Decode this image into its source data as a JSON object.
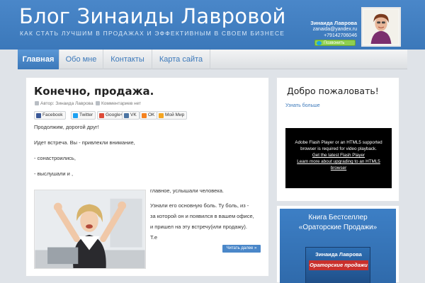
{
  "header": {
    "title": "Блог Зинаиды Лавровой",
    "tagline": "Как стать лучшим в продажах и эффективным в своем бизнесе",
    "contact": {
      "name": "Зинаида Лаврова",
      "email": "zanaida@yandex.ru",
      "phone": "+79142706046",
      "call_label": "Позвонить",
      "call_icon": "skype-icon"
    }
  },
  "nav": {
    "items": [
      "Главная",
      "Обо мне",
      "Контакты",
      "Карта сайта"
    ],
    "active": "Главная"
  },
  "post": {
    "title": "Конечно, продажа.",
    "author": "Автор: Зинаида Лаврова",
    "comments": "Комментариев нет",
    "share": [
      {
        "label": "Facebook",
        "color": "#3b5998"
      },
      {
        "label": "Twitter",
        "color": "#1da1f2"
      },
      {
        "label": "Google+",
        "color": "#dd4b39"
      },
      {
        "label": "VK",
        "color": "#4c75a3"
      },
      {
        "label": "OK",
        "color": "#f58220"
      },
      {
        "label": "Мой Мир",
        "color": "#f5a623"
      }
    ],
    "paragraphs": [
      "Продолжим, дорогой друг!",
      "Идет встреча. Вы - привлекли внимание,",
      "- сонастроились,",
      "- выслушали и ,"
    ],
    "side_text": [
      "главное, услышали человека.",
      "Узнали его основную боль. Ту боль, из -",
      "за которой он и появился в вашем офисе,",
      "и пришел на эту встречу(или продажу).",
      "Т.е"
    ],
    "read_more": "Читать далее »"
  },
  "sidebar": {
    "welcome": {
      "title": "Добро пожаловать!",
      "link": "Узнать больше",
      "video_message": [
        "Adobe Flash Player or an HTML5 supported",
        "browser is required for video playback.",
        "Get the latest Flash Player",
        "Learn more about upgrading to an HTML5",
        "browser"
      ]
    },
    "book": {
      "title_line1": "Книга Бестселлер",
      "title_line2": "«Ораторские Продажи»",
      "cover_author": "Зинаида Лаврова",
      "cover_title": "Ораторские продажи"
    }
  },
  "colors": {
    "header_blue": "#3b78ba",
    "link_blue": "#3b78ba",
    "page_bg": "#dfe3e8"
  }
}
